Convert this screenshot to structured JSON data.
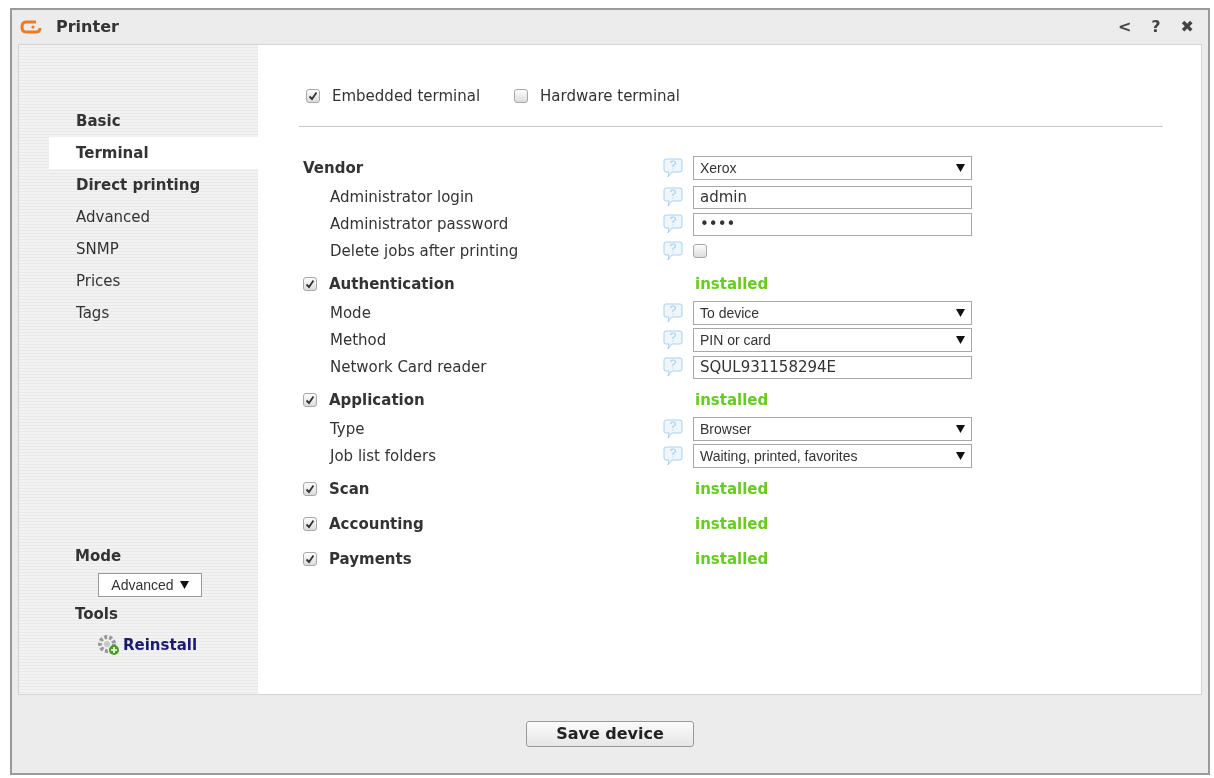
{
  "window": {
    "title": "Printer",
    "controls": [
      "<",
      "?",
      "✖"
    ]
  },
  "sidebar": {
    "items": [
      {
        "label": "Basic",
        "bold": true,
        "selected": false
      },
      {
        "label": "Terminal",
        "bold": true,
        "selected": true
      },
      {
        "label": "Direct printing",
        "bold": true,
        "selected": false
      },
      {
        "label": "Advanced",
        "bold": false,
        "selected": false
      },
      {
        "label": "SNMP",
        "bold": false,
        "selected": false
      },
      {
        "label": "Prices",
        "bold": false,
        "selected": false
      },
      {
        "label": "Tags",
        "bold": false,
        "selected": false
      }
    ],
    "mode_label": "Mode",
    "mode_value": "Advanced",
    "tools_label": "Tools",
    "tools": [
      {
        "label": "Reinstall"
      }
    ]
  },
  "terminal_types": [
    {
      "label": "Embedded terminal",
      "checked": true
    },
    {
      "label": "Hardware terminal",
      "checked": false
    }
  ],
  "sections": [
    {
      "title": "Vendor",
      "control": {
        "kind": "select",
        "value": "Xerox"
      },
      "fields": [
        {
          "label": "Administrator login",
          "kind": "text",
          "value": "admin"
        },
        {
          "label": "Administrator password",
          "kind": "password",
          "value": "••••"
        },
        {
          "label": "Delete jobs after printing",
          "kind": "checkbox",
          "checked": false
        }
      ]
    },
    {
      "title": "Authentication",
      "checked": true,
      "status": "installed",
      "fields": [
        {
          "label": "Mode",
          "kind": "select",
          "value": "To device"
        },
        {
          "label": "Method",
          "kind": "select",
          "value": "PIN or card"
        },
        {
          "label": "Network Card reader",
          "kind": "text",
          "value": "SQUL931158294E"
        }
      ]
    },
    {
      "title": "Application",
      "checked": true,
      "status": "installed",
      "fields": [
        {
          "label": "Type",
          "kind": "select",
          "value": "Browser"
        },
        {
          "label": "Job list folders",
          "kind": "select",
          "value": "Waiting, printed, favorites"
        }
      ]
    },
    {
      "title": "Scan",
      "checked": true,
      "status": "installed"
    },
    {
      "title": "Accounting",
      "checked": true,
      "status": "installed"
    },
    {
      "title": "Payments",
      "checked": true,
      "status": "installed"
    }
  ],
  "footer": {
    "button": "Save device"
  }
}
